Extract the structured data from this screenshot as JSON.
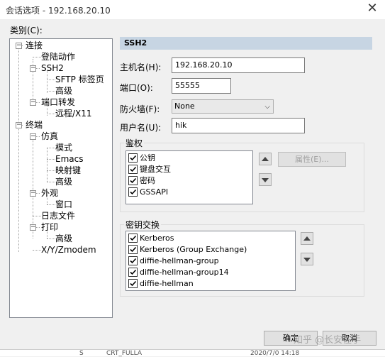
{
  "window": {
    "title": "会话选项 - 192.168.20.10",
    "close_glyph": "✕"
  },
  "category_label": "类别(C):",
  "tree": {
    "items": [
      {
        "id": "connection",
        "label": "连接"
      },
      {
        "id": "login-actions",
        "label": "登陆动作"
      },
      {
        "id": "ssh2",
        "label": "SSH2"
      },
      {
        "id": "sftp-tab",
        "label": "SFTP 标签页"
      },
      {
        "id": "advanced-ssh2",
        "label": "高级"
      },
      {
        "id": "port-forwarding",
        "label": "端口转发"
      },
      {
        "id": "remote-x11",
        "label": "远程/X11"
      },
      {
        "id": "terminal",
        "label": "终端"
      },
      {
        "id": "emulation",
        "label": "仿真"
      },
      {
        "id": "modes",
        "label": "模式"
      },
      {
        "id": "emacs",
        "label": "Emacs"
      },
      {
        "id": "mapped-keys",
        "label": "映射键"
      },
      {
        "id": "advanced-emulation",
        "label": "高级"
      },
      {
        "id": "appearance",
        "label": "外观"
      },
      {
        "id": "window",
        "label": "窗口"
      },
      {
        "id": "log-file",
        "label": "日志文件"
      },
      {
        "id": "printing",
        "label": "打印"
      },
      {
        "id": "advanced-printing",
        "label": "高级"
      },
      {
        "id": "xyzmodem",
        "label": "X/Y/Zmodem"
      }
    ]
  },
  "section": {
    "title": "SSH2"
  },
  "form": {
    "hostname_label": "主机名(H):",
    "hostname_value": "192.168.20.10",
    "port_label": "端口(O):",
    "port_value": "55555",
    "firewall_label": "防火墙(F):",
    "firewall_value": "None",
    "username_label": "用户名(U):",
    "username_value": "hik"
  },
  "auth": {
    "legend": "鉴权",
    "items": [
      {
        "label": "公钥",
        "checked": true
      },
      {
        "label": "键盘交互",
        "checked": true
      },
      {
        "label": "密码",
        "checked": true
      },
      {
        "label": "GSSAPI",
        "checked": true
      }
    ],
    "properties_button": "属性(E)..."
  },
  "kex": {
    "legend": "密钥交换",
    "items": [
      {
        "label": "Kerberos",
        "checked": true
      },
      {
        "label": "Kerberos (Group Exchange)",
        "checked": true
      },
      {
        "label": "diffie-hellman-group",
        "checked": true
      },
      {
        "label": "diffie-hellman-group14",
        "checked": true
      },
      {
        "label": "diffie-hellman",
        "checked": true
      }
    ]
  },
  "buttons": {
    "ok": "确定",
    "cancel": "取消"
  },
  "bottom_strip": {
    "text1": "S",
    "text2": "CRT_FULLA",
    "text3": "2020/7/0 14:18"
  },
  "watermark": "知乎 @长安在手",
  "colors": {
    "section_header": "#c7d5e3",
    "window_bg": "#f0f0f0"
  }
}
